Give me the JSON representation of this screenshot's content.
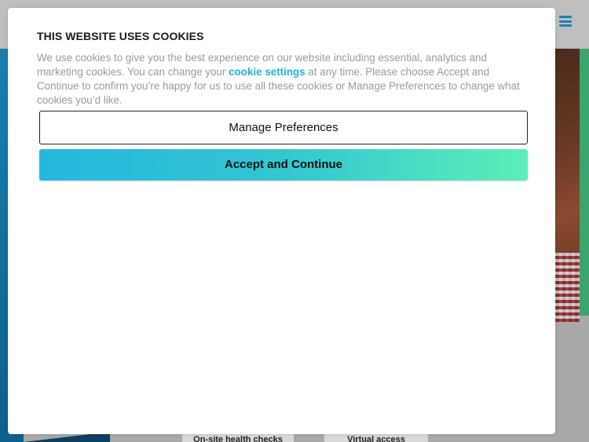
{
  "cookie_modal": {
    "title": "THIS WEBSITE USES COOKIES",
    "body_before_link": "We use cookies to give you the best experience on our website including essential, analytics and marketing cookies. You can change your ",
    "link_text": "cookie settings",
    "body_after_link": " at any time. Please choose Accept and Continue to confirm you’re happy for us to use all these cookies or Manage Preferences to change what cookies you’d like.",
    "manage_label": "Manage Preferences",
    "accept_label": "Accept and Continue"
  },
  "background": {
    "cards": [
      {
        "label": "On-site health checks"
      },
      {
        "label": "Virtual access"
      }
    ],
    "menu_icon": "hamburger-menu-icon"
  },
  "colors": {
    "link": "#1fb3d8",
    "accept_gradient_start": "#25b8df",
    "accept_gradient_end": "#5ceeb8",
    "menu_icon": "#1e7fb8"
  }
}
